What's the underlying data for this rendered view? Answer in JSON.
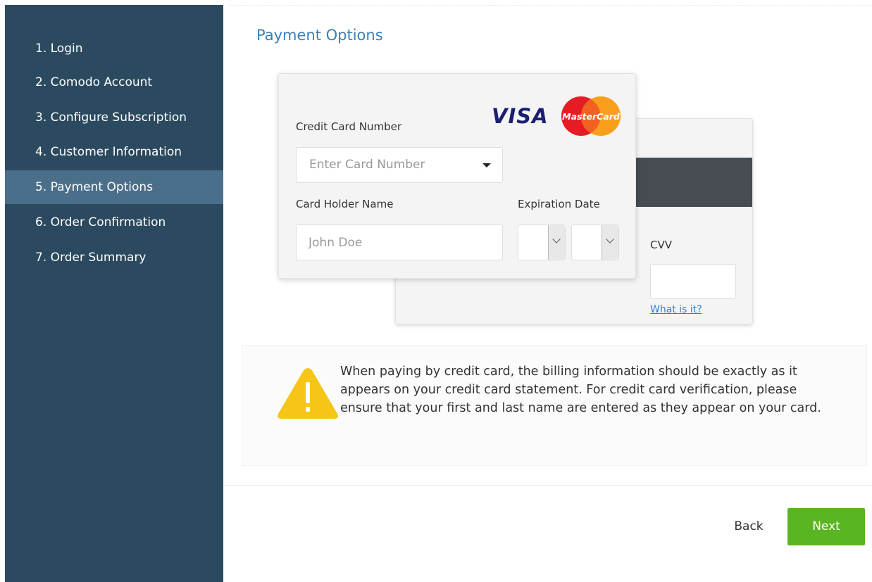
{
  "sidebar": {
    "items": [
      {
        "label": "1. Login"
      },
      {
        "label": "2. Comodo Account"
      },
      {
        "label": "3. Configure Subscription"
      },
      {
        "label": "4. Customer Information"
      },
      {
        "label": "5. Payment Options",
        "active": true
      },
      {
        "label": "6. Order Confirmation"
      },
      {
        "label": "7. Order Summary"
      }
    ]
  },
  "main": {
    "title": "Payment Options",
    "card_front": {
      "card_number_label": "Credit Card Number",
      "card_number_placeholder": "Enter Card Number",
      "holder_name_label": "Card Holder Name",
      "holder_name_placeholder": "John Doe",
      "expiration_label": "Expiration Date",
      "visa_logo_text": "VISA",
      "mastercard_logo_text": "MasterCard"
    },
    "card_back": {
      "cvv_label": "CVV",
      "cvv_value": "",
      "help_link": "What is it?"
    },
    "warning": {
      "text": "When paying by credit card, the billing information should be exactly as it appears on your credit card statement. For credit card verification, please ensure that your first and last name are entered as they appear on your card."
    }
  },
  "footer": {
    "back_label": "Back",
    "next_label": "Next"
  },
  "colors": {
    "sidebar_bg": "#2b4a5f",
    "sidebar_active": "#4b6f8a",
    "title": "#3a7fb5",
    "next_button": "#5ab522",
    "link": "#2f7fd0",
    "warning_icon": "#f5c518"
  }
}
